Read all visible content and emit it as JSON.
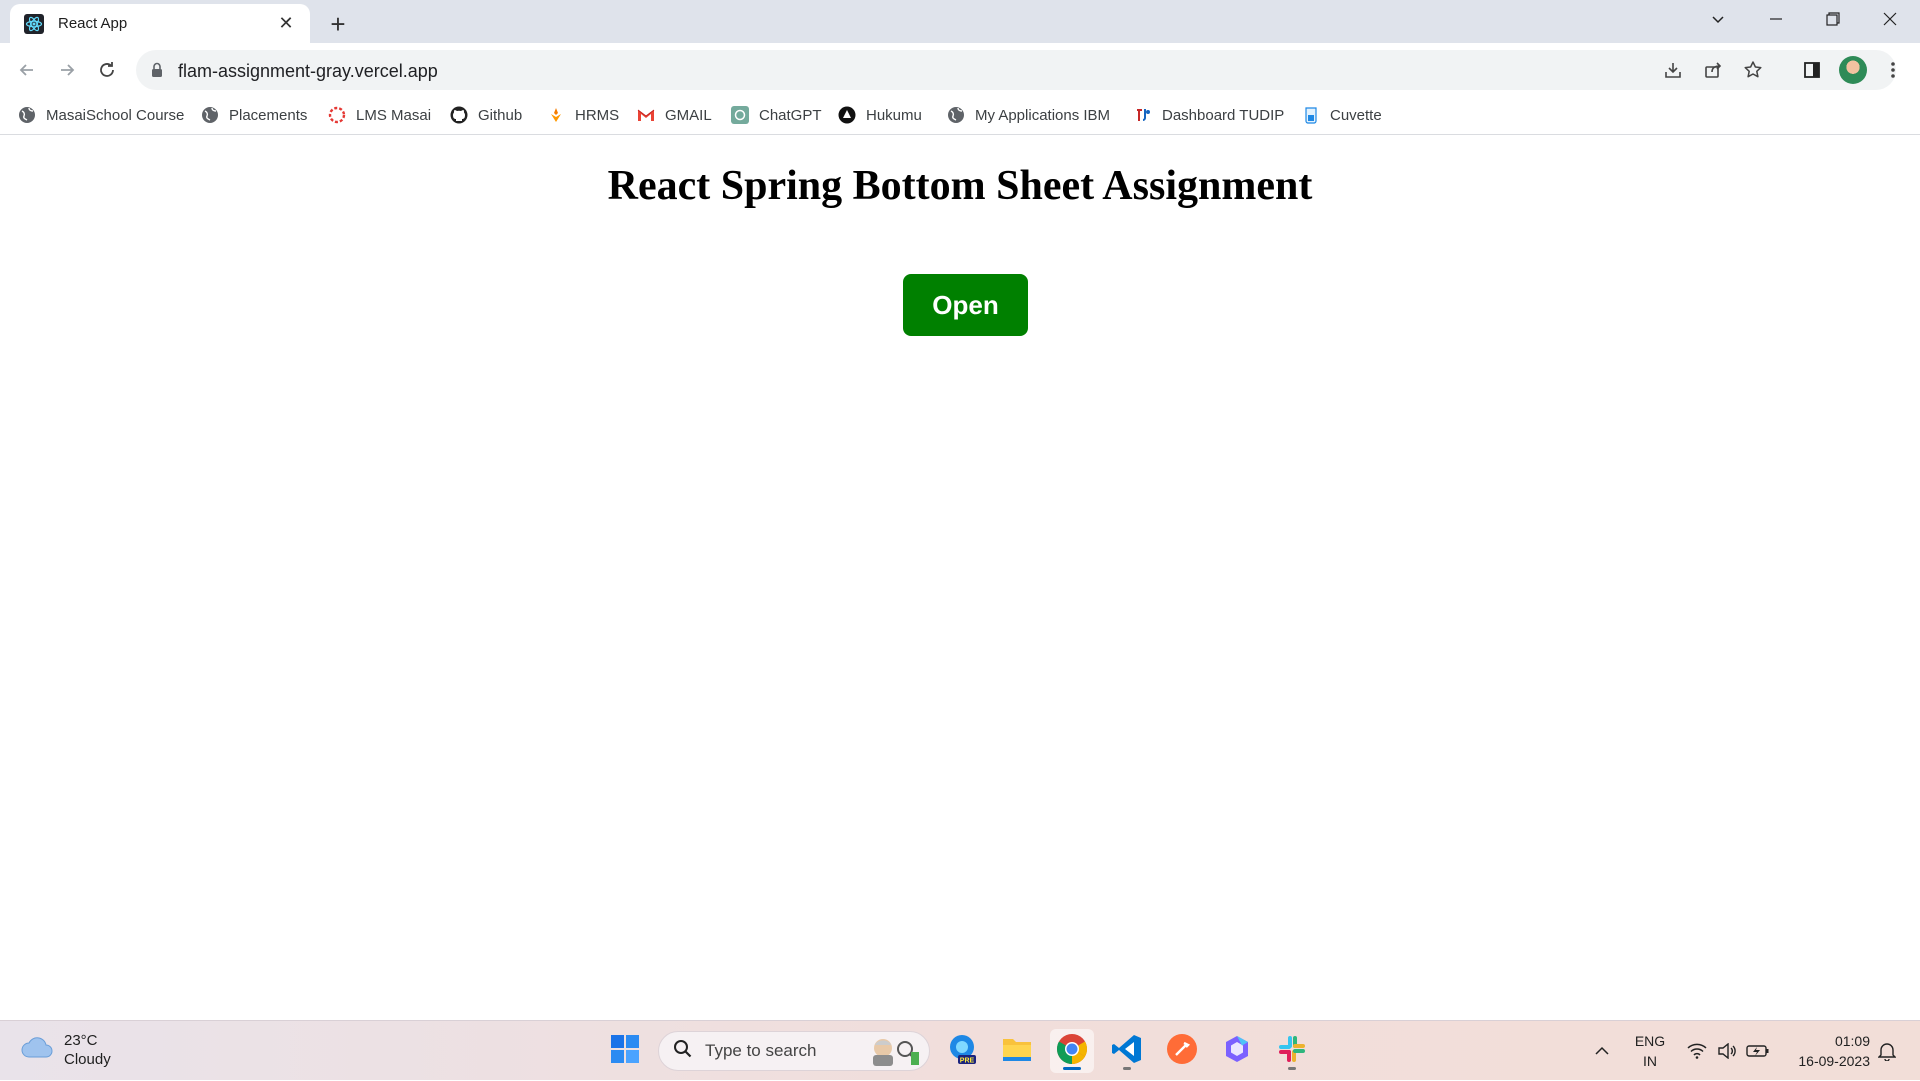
{
  "browser": {
    "tab": {
      "title": "React App"
    },
    "address": {
      "url": "flam-assignment-gray.vercel.app"
    },
    "bookmarks": [
      {
        "label": "MasaiSchool Course",
        "icon": "globe-icon"
      },
      {
        "label": "Placements",
        "icon": "globe-icon"
      },
      {
        "label": "LMS Masai",
        "icon": "masai-icon"
      },
      {
        "label": "Github",
        "icon": "github-icon"
      },
      {
        "label": "HRMS",
        "icon": "hrms-icon"
      },
      {
        "label": "GMAIL",
        "icon": "gmail-icon"
      },
      {
        "label": "ChatGPT",
        "icon": "chatgpt-icon"
      },
      {
        "label": "Hukumu",
        "icon": "hukumu-icon"
      },
      {
        "label": "My Applications IBM",
        "icon": "globe-icon"
      },
      {
        "label": "Dashboard TUDIP",
        "icon": "tudip-icon"
      },
      {
        "label": "Cuvette",
        "icon": "cuvette-icon"
      }
    ]
  },
  "page": {
    "heading": "React Spring Bottom Sheet Assignment",
    "open_button": "Open",
    "accent_color": "#008000"
  },
  "taskbar": {
    "weather": {
      "temp": "23°C",
      "condition": "Cloudy"
    },
    "search_placeholder": "Type to search",
    "language": {
      "line1": "ENG",
      "line2": "IN"
    },
    "clock": {
      "time": "01:09",
      "date": "16-09-2023"
    }
  }
}
